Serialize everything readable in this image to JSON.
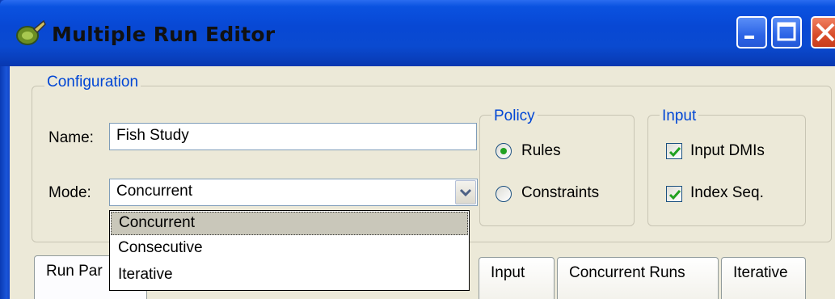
{
  "window": {
    "title": "Multiple Run Editor"
  },
  "configuration": {
    "group_label": "Configuration",
    "name_label": "Name:",
    "name_value": "Fish Study",
    "mode_label": "Mode:",
    "mode_value": "Concurrent",
    "mode_options": [
      "Concurrent",
      "Consecutive",
      "Iterative"
    ]
  },
  "policy": {
    "group_label": "Policy",
    "options": [
      {
        "label": "Rules",
        "checked": true
      },
      {
        "label": "Constraints",
        "checked": false
      }
    ]
  },
  "input": {
    "group_label": "Input",
    "options": [
      {
        "label": "Input DMIs",
        "checked": true
      },
      {
        "label": "Index Seq.",
        "checked": true
      }
    ]
  },
  "tabs": [
    "Run Par",
    "Input",
    "Concurrent Runs",
    "Iterative"
  ],
  "colors": {
    "title_bar": "#0848d4",
    "group_label": "#0046d5",
    "radio_dot": "#21a121",
    "check_mark": "#21a121",
    "close_button": "#d84c2a"
  }
}
